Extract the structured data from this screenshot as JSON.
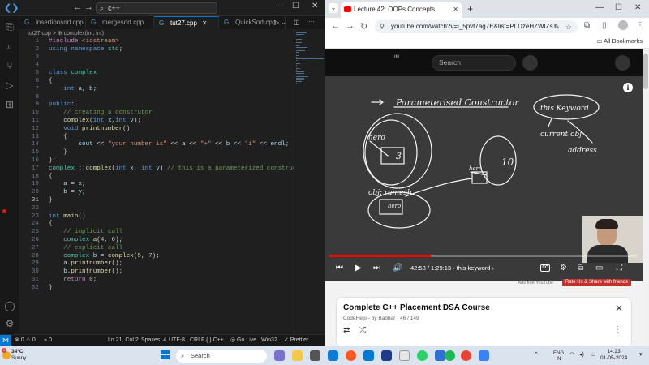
{
  "vscode": {
    "search_text": "c++",
    "tabs": [
      {
        "label": "insertionsort.cpp",
        "active": false
      },
      {
        "label": "mergesort.cpp",
        "active": false
      },
      {
        "label": "tut27.cpp",
        "active": true
      },
      {
        "label": "QuickSort.cpp",
        "active": false
      }
    ],
    "breadcrumb": "tut27.cpp > ⊕ complex(int, int)",
    "lines": [
      {
        "n": "1",
        "html": "<span class='p'>#include</span> <span class='s'>&lt;iostream&gt;</span>"
      },
      {
        "n": "2",
        "html": "<span class='k'>using</span> <span class='k'>namespace</span> <span class='t'>std</span>;"
      },
      {
        "n": "3",
        "html": ""
      },
      {
        "n": "4",
        "html": ""
      },
      {
        "n": "5",
        "html": "<span class='k'>class</span> <span class='t'>complex</span>"
      },
      {
        "n": "6",
        "html": "{"
      },
      {
        "n": "7",
        "html": "    <span class='k'>int</span> <span class='v'>a</span>, <span class='v'>b</span>;"
      },
      {
        "n": "8",
        "html": ""
      },
      {
        "n": "9",
        "html": "<span class='k'>public</span>:"
      },
      {
        "n": "10",
        "html": "    <span class='c'>// creating a construtor</span>"
      },
      {
        "n": "11",
        "html": "    <span class='f'>complex</span>(<span class='k'>int</span> <span class='v'>x</span>,<span class='k'>int</span> <span class='v'>y</span>);"
      },
      {
        "n": "12",
        "html": "    <span class='k'>void</span> <span class='f'>printnumber</span>()"
      },
      {
        "n": "13",
        "html": "    {"
      },
      {
        "n": "14",
        "html": "        <span class='v'>cout</span> &lt;&lt; <span class='s'>\"your number is\"</span> &lt;&lt; <span class='v'>a</span> &lt;&lt; <span class='s'>\"+\"</span> &lt;&lt; <span class='v'>b</span> &lt;&lt; <span class='s'>\"i\"</span> &lt;&lt; <span class='v'>endl</span>;"
      },
      {
        "n": "15",
        "html": "    }"
      },
      {
        "n": "16",
        "html": "};"
      },
      {
        "n": "17",
        "html": "<span class='t'>complex</span> ::<span class='f'>complex</span>(<span class='k'>int</span> <span class='v'>x</span>, <span class='k'>int</span> <span class='v'>y</span>) <span class='c'>// this is a parameterized constructor as</span>"
      },
      {
        "n": "18",
        "html": "{"
      },
      {
        "n": "19",
        "html": "    <span class='v'>a</span> = <span class='v'>x</span>;"
      },
      {
        "n": "20",
        "html": "    <span class='v'>b</span> = <span class='v'>y</span>;"
      },
      {
        "n": "21",
        "html": "}"
      },
      {
        "n": "22",
        "html": ""
      },
      {
        "n": "23",
        "html": "<span class='k'>int</span> <span class='f'>main</span>()"
      },
      {
        "n": "24",
        "html": "{"
      },
      {
        "n": "25",
        "html": "    <span class='c'>// implicit call</span>"
      },
      {
        "n": "26",
        "html": "    <span class='t'>complex</span> <span class='f'>a</span>(<span class='n'>4</span>, <span class='n'>6</span>);"
      },
      {
        "n": "27",
        "html": "    <span class='c'>// explicit call</span>"
      },
      {
        "n": "28",
        "html": "    <span class='t'>complex</span> <span class='v'>b</span> = <span class='f'>complex</span>(<span class='n'>5</span>, <span class='n'>7</span>);"
      },
      {
        "n": "29",
        "html": "    <span class='v'>a</span>.<span class='f'>printnumber</span>();"
      },
      {
        "n": "30",
        "html": "    <span class='v'>b</span>.<span class='f'>printnumber</span>();"
      },
      {
        "n": "31",
        "html": "    <span class='p'>return</span> <span class='n'>0</span>;"
      },
      {
        "n": "32",
        "html": "}"
      }
    ],
    "status": {
      "errors": "⊗ 0 ⚠ 0",
      "ports": "⌁ 0",
      "position": "Ln 21, Col 2",
      "spaces": "Spaces: 4",
      "encoding": "UTF-8",
      "eol": "CRLF",
      "language": "{ } C++",
      "golive": "◎ Go Live",
      "platform": "Win32",
      "prettier": "✓ Prettier"
    }
  },
  "chrome": {
    "tab_title": "Lecture 42: OOPs Concepts",
    "url": "youtube.com/watch?v=i_5pvt7ag7E&list=PLDzeHZWIZsT...",
    "bookmarks_label": "All Bookmarks"
  },
  "youtube": {
    "country": "IN",
    "search_placeholder": "Search",
    "progress": 0.33,
    "time": "42:58 / 1:29:13",
    "chapter": "· this keyword",
    "ads_text": "Ads free YouTube",
    "rate_label": "Rate Us & Share with friends",
    "course_title": "Complete C++ Placement DSA Course",
    "course_sub": "CodeHelp - by Babbar · 46 / 149",
    "board_text": {
      "heading": "Parameterised Constructor",
      "this_kw": "this Keyword",
      "current": "current obj",
      "address": "address",
      "hero": "hero",
      "three": "3",
      "ten": "10",
      "hero2": "hero",
      "obj": "obj: ramesh",
      "hero3": "hero"
    }
  },
  "taskbar": {
    "temp": "34°C",
    "weather": "Sunny",
    "badge": "1",
    "search_placeholder": "Search",
    "lang_line1": "ENG",
    "lang_line2": "IN",
    "time": "14:23",
    "date": "01-05-2024"
  }
}
